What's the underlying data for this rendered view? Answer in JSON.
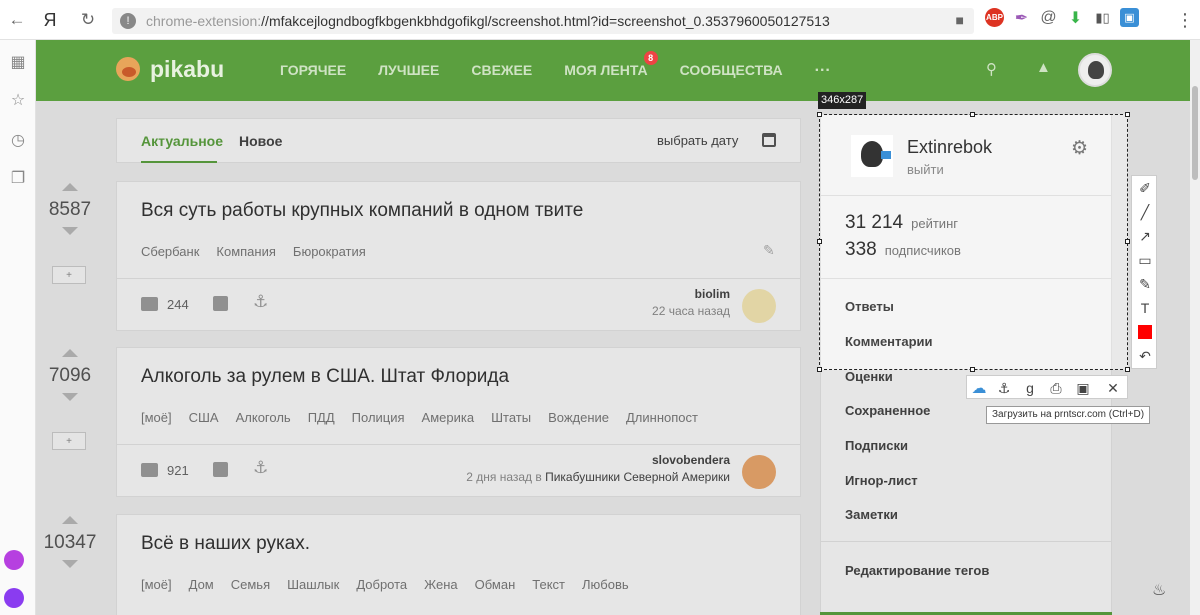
{
  "browser": {
    "url_scheme": "chrome-extension:",
    "url_rest": "//mfakcejlogndbogfkbgenkbhdgofikgl/screenshot.html?id=screenshot_0.3537960050127513",
    "yandex_logo": "Я",
    "ext_abp": "ABP"
  },
  "site": {
    "logo": "pikabu",
    "nav": [
      "ГОРЯЧЕЕ",
      "ЛУЧШЕЕ",
      "СВЕЖЕЕ",
      "МОЯ ЛЕНТА",
      "СООБЩЕСТВА"
    ],
    "nav_badge": "8",
    "nav_more": "···"
  },
  "tabs": {
    "active": "Актуальное",
    "other": "Новое",
    "date_pick": "выбрать дату"
  },
  "stories": [
    {
      "votes": "8587",
      "title": "Вся суть работы крупных компаний в одном твите",
      "tags": [
        "Сбербанк",
        "Компания",
        "Бюрократия"
      ],
      "comments": "244",
      "author": "biolim",
      "posted": "22 часа назад",
      "community": ""
    },
    {
      "votes": "7096",
      "title": "Алкоголь за рулем в США. Штат Флорида",
      "tags": [
        "[моё]",
        "США",
        "Алкоголь",
        "ПДД",
        "Полиция",
        "Америка",
        "Штаты",
        "Вождение",
        "Длиннопост"
      ],
      "comments": "921",
      "author": "slovobendera",
      "posted": "2 дня назад в",
      "community": "Пикабушники Северной Америки"
    },
    {
      "votes": "10347",
      "title": "Всё в наших руках.",
      "tags": [
        "[моё]",
        "Дом",
        "Семья",
        "Шашлык",
        "Доброта",
        "Жена",
        "Обман",
        "Текст",
        "Любовь"
      ]
    }
  ],
  "vote_save_label": "+",
  "user_panel": {
    "name": "Extinrebok",
    "logout": "выйти",
    "rating_value": "31 214",
    "rating_label": "рейтинг",
    "subs_value": "338",
    "subs_label": "подписчиков",
    "links": [
      "Ответы",
      "Комментарии",
      "Оценки",
      "Сохраненное",
      "Подписки",
      "Игнор-лист",
      "Заметки"
    ],
    "edit_tags": "Редактирование тегов"
  },
  "capture_tool": {
    "size_label": "346x287",
    "tooltip": "Загрузить на prntscr.com (Ctrl+D)",
    "color": "#ff0000"
  }
}
